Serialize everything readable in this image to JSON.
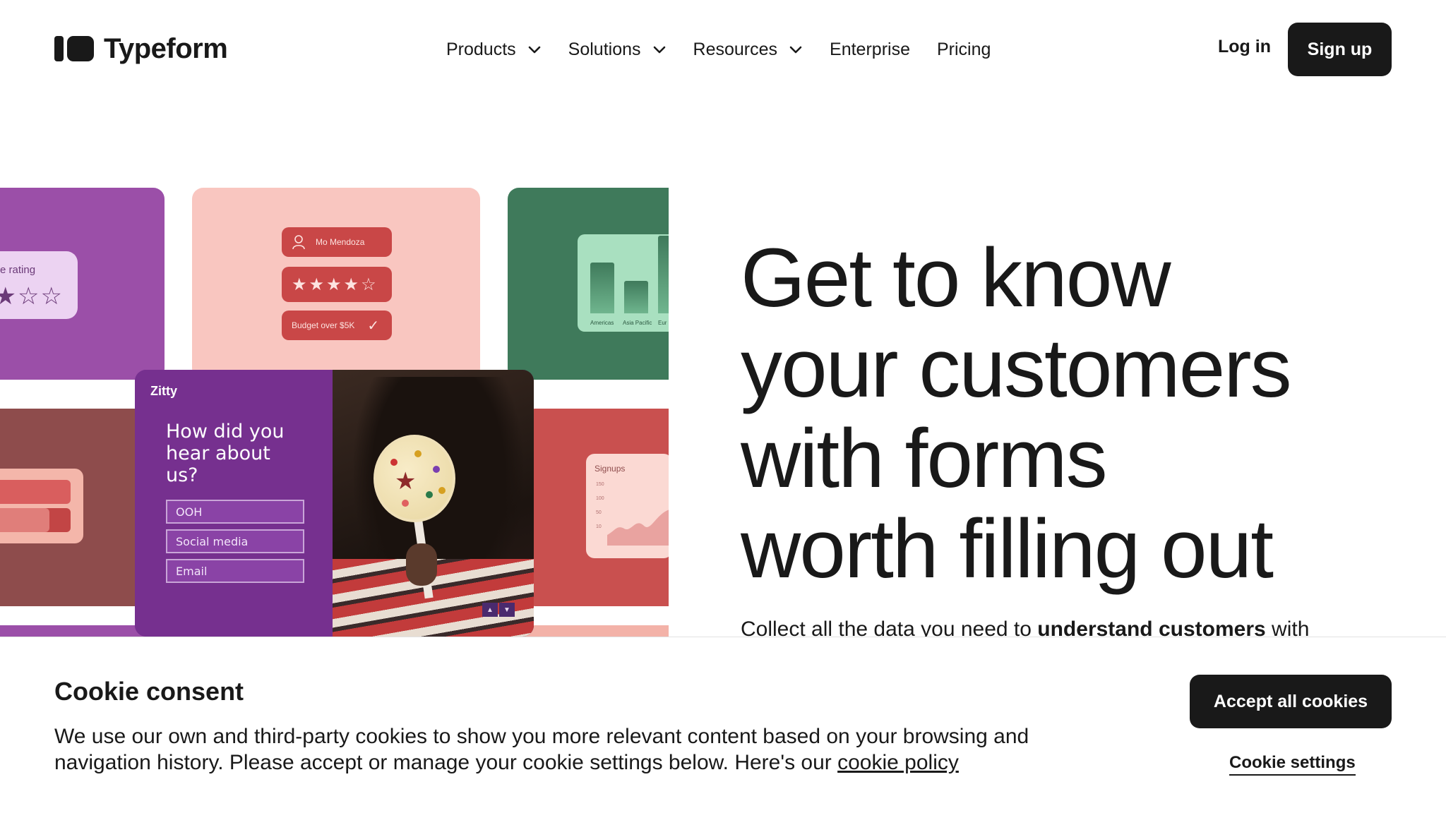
{
  "brand": {
    "name": "Typeform"
  },
  "nav": {
    "items": [
      {
        "label": "Products",
        "has_dropdown": true
      },
      {
        "label": "Solutions",
        "has_dropdown": true
      },
      {
        "label": "Resources",
        "has_dropdown": true
      },
      {
        "label": "Enterprise",
        "has_dropdown": false
      },
      {
        "label": "Pricing",
        "has_dropdown": false
      }
    ],
    "login_label": "Log in",
    "signup_label": "Sign up"
  },
  "collage": {
    "rating_label": "erage rating",
    "rating_stars": "★★☆☆",
    "profile_name": "Mo Mendoza",
    "stars_pill": "★★★★☆",
    "budget_label": "Budget over $5K",
    "chart_labels": [
      "Americas",
      "Asia Pacific",
      "Eur"
    ],
    "signups_label": "Signups",
    "signups_ticks": [
      "150",
      "100",
      "50",
      "10"
    ],
    "form_brand": "Zitty",
    "form_question": "How did you hear about us?",
    "form_options": [
      "OOH",
      "Social media",
      "Email"
    ]
  },
  "hero": {
    "headline_lines": [
      "Get to know",
      "your customers",
      "with forms",
      "worth filling out"
    ],
    "subtext_prefix": "Collect all the data you need to ",
    "subtext_bold": "understand customers",
    "subtext_suffix": " with"
  },
  "cookie": {
    "title": "Cookie consent",
    "text": "We use our own and third-party cookies to show you more relevant content based on your browsing and navigation history. Please accept or manage your cookie settings below. Here's our ",
    "link_label": "cookie policy",
    "accept_label": "Accept all cookies",
    "settings_label": "Cookie settings"
  },
  "colors": {
    "ink": "#191919",
    "purple": "#9b4fa8",
    "pink": "#f9c6c0",
    "green": "#3f7a5b",
    "red": "#c9504f"
  }
}
